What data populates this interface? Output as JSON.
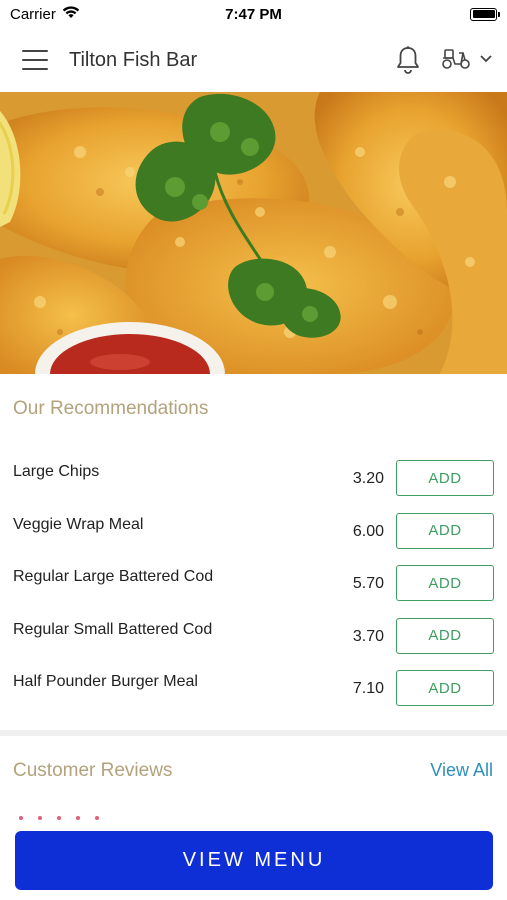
{
  "status_bar": {
    "carrier": "Carrier",
    "time": "7:47 PM"
  },
  "header": {
    "title": "Tilton Fish Bar",
    "menu_icon": "hamburger-menu-icon",
    "notification_icon": "bell-icon",
    "delivery_icon": "scooter-icon",
    "dropdown_icon": "chevron-down-icon"
  },
  "recommendations": {
    "title": "Our Recommendations",
    "items": [
      {
        "name": "Large Chips",
        "price": "3.20",
        "button": "ADD"
      },
      {
        "name": "Veggie Wrap Meal",
        "price": "6.00",
        "button": "ADD"
      },
      {
        "name": "Regular Large Battered Cod",
        "price": "5.70",
        "button": "ADD"
      },
      {
        "name": "Regular Small Battered Cod",
        "price": "3.70",
        "button": "ADD"
      },
      {
        "name": "Half Pounder Burger Meal",
        "price": "7.10",
        "button": "ADD"
      }
    ]
  },
  "reviews": {
    "title": "Customer Reviews",
    "view_all": "View All"
  },
  "footer": {
    "button": "VIEW MENU"
  },
  "colors": {
    "accent_title": "#b3a27c",
    "add_green": "#3f9e62",
    "link_blue": "#2e8fbf",
    "cta_blue": "#0f2fd6"
  }
}
